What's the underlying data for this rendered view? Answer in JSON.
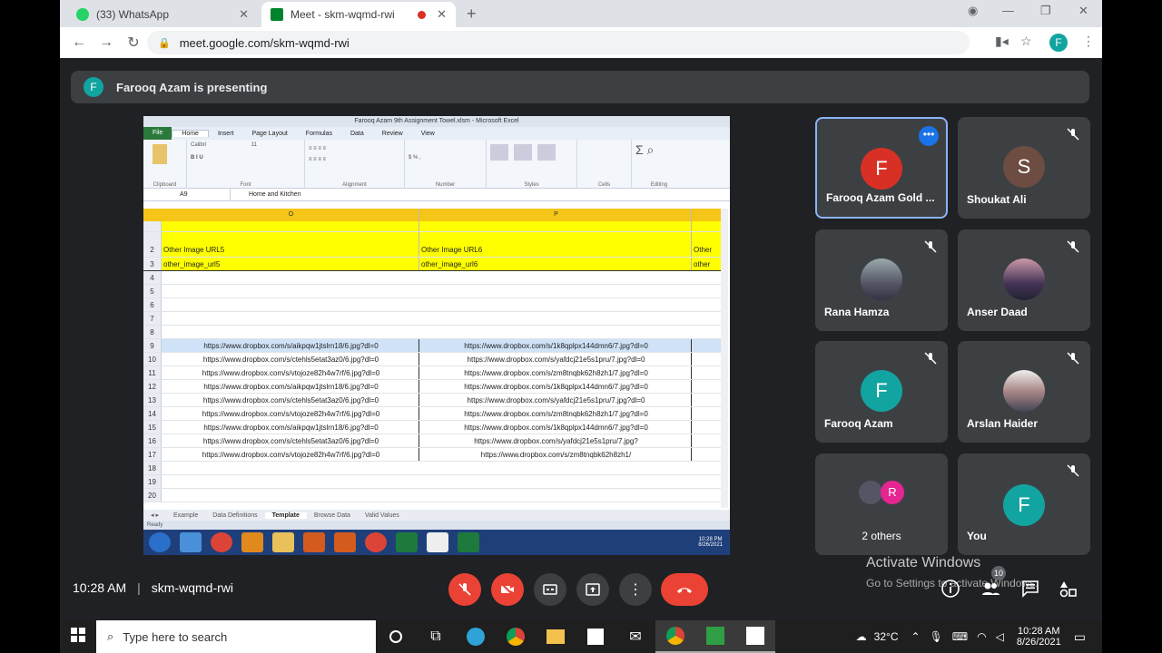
{
  "browser": {
    "tabs": [
      {
        "label": "(33) WhatsApp"
      },
      {
        "label": "Meet - skm-wqmd-rwi"
      }
    ],
    "url": "meet.google.com/skm-wqmd-rwi",
    "profile_initial": "F"
  },
  "banner": {
    "initial": "F",
    "text": "Farooq Azam is presenting"
  },
  "excel": {
    "title": "Farooq Azam 9th Assignment Towel.xlsm - Microsoft Excel",
    "tabs": [
      "File",
      "Home",
      "Insert",
      "Page Layout",
      "Formulas",
      "Data",
      "Review",
      "View"
    ],
    "name_box": "A9",
    "formula": "Home and Kitchen",
    "col_headers": [
      "O",
      "P"
    ],
    "groups": [
      "Clipboard",
      "Font",
      "Alignment",
      "Number",
      "Styles",
      "Cells",
      "Editing"
    ],
    "font_name": "Calibri",
    "font_size": "11",
    "row2": [
      "Other Image URL5",
      "Other Image URL6",
      "Other"
    ],
    "row3": [
      "other_image_url5",
      "other_image_url6",
      "other"
    ],
    "url_rows": [
      {
        "n": "9",
        "a": "https://www.dropbox.com/s/aikpqw1jtslrn18/6.jpg?dl=0",
        "b": "https://www.dropbox.com/s/1k8qplpx144dmn6/7.jpg?dl=0"
      },
      {
        "n": "10",
        "a": "https://www.dropbox.com/s/ctehls5etat3az0/6.jpg?dl=0",
        "b": "https://www.dropbox.com/s/yafdcj21e5s1pru/7.jpg?dl=0"
      },
      {
        "n": "11",
        "a": "https://www.dropbox.com/s/vtojoze82h4w7rf/6.jpg?dl=0",
        "b": "https://www.dropbox.com/s/zm8tnqbk62h8zh1/7.jpg?dl=0"
      },
      {
        "n": "12",
        "a": "https://www.dropbox.com/s/aikpqw1jtslrn18/6.jpg?dl=0",
        "b": "https://www.dropbox.com/s/1k8qplpx144dmn6/7.jpg?dl=0"
      },
      {
        "n": "13",
        "a": "https://www.dropbox.com/s/ctehls5etat3az0/6.jpg?dl=0",
        "b": "https://www.dropbox.com/s/yafdcj21e5s1pru/7.jpg?dl=0"
      },
      {
        "n": "14",
        "a": "https://www.dropbox.com/s/vtojoze82h4w7rf/6.jpg?dl=0",
        "b": "https://www.dropbox.com/s/zm8tnqbk62h8zh1/7.jpg?dl=0"
      },
      {
        "n": "15",
        "a": "https://www.dropbox.com/s/aikpqw1jtslrn18/6.jpg?dl=0",
        "b": "https://www.dropbox.com/s/1k8qplpx144dmn6/7.jpg?dl=0"
      },
      {
        "n": "16",
        "a": "https://www.dropbox.com/s/ctehls5etat3az0/6.jpg?dl=0",
        "b": "https://www.dropbox.com/s/yafdcj21e5s1pru/7.jpg?"
      },
      {
        "n": "17",
        "a": "https://www.dropbox.com/s/vtojoze82h4w7rf/6.jpg?dl=0",
        "b": "https://www.dropbox.com/s/zm8tnqbk62h8zh1/"
      }
    ],
    "sheets": [
      "Example",
      "Data Definitions",
      "Template",
      "Browse Data",
      "Valid Values"
    ],
    "status": "Ready",
    "clock": "10:28 PM",
    "date": "8/26/2021"
  },
  "participants": [
    {
      "name": "Farooq Azam Gold ...",
      "initial": "F",
      "color": "#d93025"
    },
    {
      "name": "Shoukat Ali",
      "initial": "S",
      "color": "#6d4c41"
    },
    {
      "name": "Rana Hamza",
      "initial": ""
    },
    {
      "name": "Anser Daad",
      "initial": ""
    },
    {
      "name": "Farooq Azam",
      "initial": "F",
      "color": "#12a4a0"
    },
    {
      "name": "Arslan Haider",
      "initial": ""
    },
    {
      "name": "2 others",
      "initial": "R",
      "color": "#e52592"
    },
    {
      "name": "You",
      "initial": "F",
      "color": "#12a4a0"
    }
  ],
  "meeting": {
    "time": "10:28 AM",
    "code": "skm-wqmd-rwi",
    "people_count": "10"
  },
  "activate": {
    "title": "Activate Windows",
    "sub": "Go to Settings to activate Windows."
  },
  "taskbar": {
    "search_placeholder": "Type here to search",
    "temp": "32°C",
    "time": "10:28 AM",
    "date": "8/26/2021"
  }
}
